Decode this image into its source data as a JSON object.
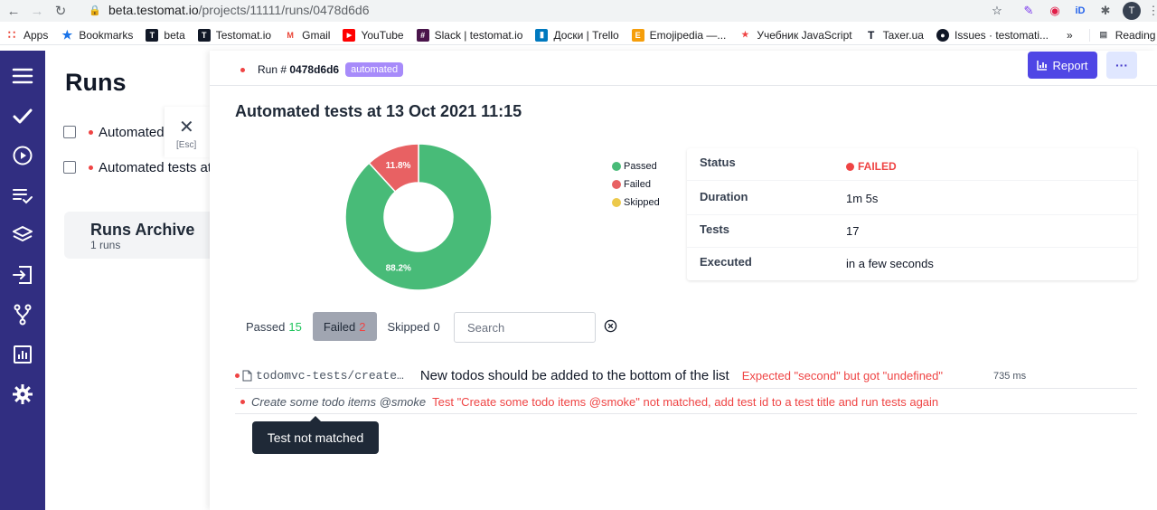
{
  "browser": {
    "url_host": "beta.testomat.io",
    "url_path": "/projects/11111/runs/0478d6d6",
    "bookmarks": [
      {
        "label": "Apps",
        "color": "#ea4335"
      },
      {
        "label": "Bookmarks",
        "color": "#1a73e8"
      },
      {
        "label": "beta",
        "color": "#111827"
      },
      {
        "label": "Testomat.io",
        "color": "#111827"
      },
      {
        "label": "Gmail",
        "color": "#ea4335"
      },
      {
        "label": "YouTube",
        "color": "#ff0000"
      },
      {
        "label": "Slack | testomat.io",
        "color": "#4a154b"
      },
      {
        "label": "Доски | Trello",
        "color": "#0079bf"
      },
      {
        "label": "Emojipedia —...",
        "color": "#f59e0b"
      },
      {
        "label": "Учебник JavaScript",
        "color": "#ef4444"
      },
      {
        "label": "Taxer.ua",
        "color": "#111827"
      },
      {
        "label": "Issues · testomati...",
        "color": "#111827"
      }
    ],
    "more_bookmarks": "»",
    "reading_list": "Reading List"
  },
  "left": {
    "title": "Runs",
    "runs": [
      "Automated",
      "Automated tests at"
    ],
    "archive_title": "Runs Archive",
    "archive_count": "1 runs",
    "esc_label": "[Esc]"
  },
  "run": {
    "id_label": "Run #",
    "id": "0478d6d6",
    "tag": "automated",
    "report_label": "Report",
    "more_label": "···",
    "heading": "Automated tests at 13 Oct 2021 11:15"
  },
  "chart_data": {
    "type": "pie",
    "donut": true,
    "categories": [
      "Passed",
      "Failed",
      "Skipped"
    ],
    "values": [
      88.2,
      11.8,
      0
    ],
    "labels": [
      "88.2%",
      "11.8%",
      ""
    ],
    "colors": [
      "#48bb78",
      "#e86163",
      "#ecc94b"
    ],
    "legend": "right"
  },
  "status": [
    {
      "key": "Status",
      "value": "FAILED"
    },
    {
      "key": "Duration",
      "value": "1m 5s"
    },
    {
      "key": "Tests",
      "value": "17"
    },
    {
      "key": "Executed",
      "value": "in a few seconds"
    }
  ],
  "filters": {
    "passed_label": "Passed",
    "passed_count": "15",
    "failed_label": "Failed",
    "failed_count": "2",
    "skipped_label": "Skipped",
    "skipped_count": "0",
    "search_placeholder": "Search"
  },
  "tests": [
    {
      "file": "todomvc-tests/create…",
      "title": "New todos should be added to the bottom of the list",
      "error": "Expected \"second\" but got \"undefined\"",
      "duration": "735 ms"
    },
    {
      "title": "Create some todo items @smoke",
      "error": "Test \"Create some todo items @smoke\" not matched, add test id to a test title and run tests again"
    }
  ],
  "tooltip": "Test not matched"
}
